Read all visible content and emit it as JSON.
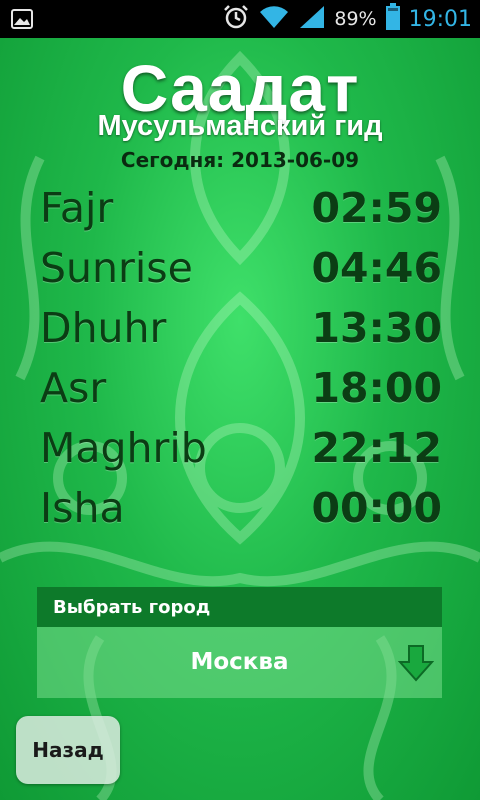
{
  "status_bar": {
    "battery_percent": "89%",
    "clock": "19:01",
    "icons": [
      "gallery-icon",
      "alarm-icon",
      "wifi-icon",
      "signal-icon",
      "battery-icon"
    ]
  },
  "header": {
    "title": "Саадат",
    "subtitle": "Мусульманский гид",
    "today_label": "Сегодня: 2013-06-09"
  },
  "prayers": [
    {
      "name": "Fajr",
      "time": "02:59"
    },
    {
      "name": "Sunrise",
      "time": "04:46"
    },
    {
      "name": "Dhuhr",
      "time": "13:30"
    },
    {
      "name": "Asr",
      "time": "18:00"
    },
    {
      "name": "Maghrib",
      "time": "22:12"
    },
    {
      "name": "Isha",
      "time": "00:00"
    }
  ],
  "city": {
    "header": "Выбрать город",
    "selected": "Москва"
  },
  "back_button": "Назад",
  "colors": {
    "background": "#1fb84a",
    "text_dark": "#0b3d14",
    "city_header": "#0d7a2a",
    "status_accent": "#33b5e5"
  }
}
